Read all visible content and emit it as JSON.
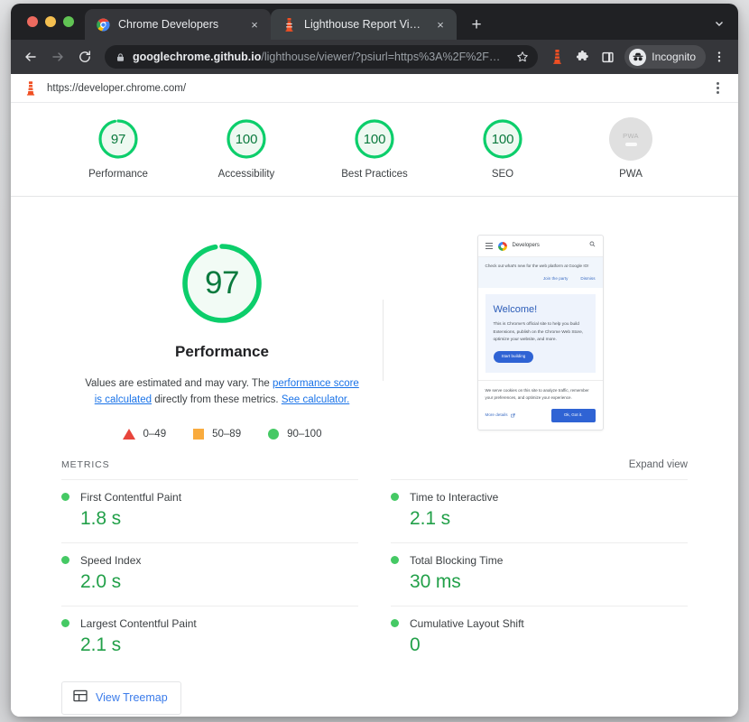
{
  "browser": {
    "tabs": [
      {
        "title": "Chrome Developers",
        "favicon": "chrome-logo-icon",
        "active": false,
        "close_label": "×"
      },
      {
        "title": "Lighthouse Report Viewer",
        "favicon": "lighthouse-icon",
        "active": true,
        "close_label": "×"
      }
    ],
    "new_tab_label": "+",
    "omnibox": {
      "host": "googlechrome.github.io",
      "path": "/lighthouse/viewer/?psiurl=https%3A%2F%2F…",
      "full_url": "googlechrome.github.io/lighthouse/viewer/?psiurl=https%3A%2F%2F…",
      "lock_icon": "lock-icon",
      "star_icon": "bookmark-star-icon"
    },
    "toolbar_icons": [
      "back-arrow-icon",
      "forward-arrow-icon",
      "reload-icon",
      "lighthouse-extension-icon",
      "extensions-puzzle-icon",
      "side-panel-icon"
    ],
    "profile_chip": {
      "label": "Incognito",
      "icon": "incognito-avatar-icon"
    },
    "menu_icon": "three-dot-menu-icon",
    "tabstrip_menu_icon": "chevron-down-icon"
  },
  "report": {
    "topbar": {
      "icon": "lighthouse-icon",
      "url": "https://developer.chrome.com/",
      "menu_icon": "three-dot-menu-icon"
    },
    "scores": [
      {
        "label": "Performance",
        "value": "97",
        "numeric": 97,
        "type": "gauge"
      },
      {
        "label": "Accessibility",
        "value": "100",
        "numeric": 100,
        "type": "gauge"
      },
      {
        "label": "Best Practices",
        "value": "100",
        "numeric": 100,
        "type": "gauge"
      },
      {
        "label": "SEO",
        "value": "100",
        "numeric": 100,
        "type": "gauge"
      },
      {
        "label": "PWA",
        "value": "PWA",
        "numeric": null,
        "type": "pwa"
      }
    ],
    "hero": {
      "score": "97",
      "score_numeric": 97,
      "title": "Performance",
      "desc_part1": "Values are estimated and may vary. The ",
      "desc_link1": "performance score is calculated",
      "desc_part2": " directly from these metrics. ",
      "desc_link2": "See calculator.",
      "legend": [
        {
          "icon": "red-triangle-icon",
          "label": "0–49"
        },
        {
          "icon": "orange-square-icon",
          "label": "50–89"
        },
        {
          "icon": "green-circle-icon",
          "label": "90–100"
        }
      ]
    },
    "thumbnail": {
      "brand": "Developers",
      "burger_icon": "hamburger-menu-icon",
      "logo_icon": "chrome-logo-icon",
      "search_icon": "search-icon",
      "banner_text": "Check out what's new for the web platform at Google IO!",
      "banner_action_1": "Join the party",
      "banner_action_2": "Dismiss",
      "hero_heading": "Welcome!",
      "hero_text": "This is Chrome's official site to help you build Extensions, publish on the Chrome Web Store, optimize your website, and more.",
      "hero_button": "Start building",
      "cookie_text": "We serve cookies on this site to analyze traffic, remember your preferences, and optimize your experience.",
      "cookie_more": "More details",
      "cookie_more_icon": "external-link-icon",
      "cookie_ok": "Ok, Got it."
    },
    "metrics_section": {
      "title": "METRICS",
      "expand_view": "Expand view"
    },
    "metrics": [
      {
        "name": "First Contentful Paint",
        "value": "1.8 s",
        "status": "pass"
      },
      {
        "name": "Time to Interactive",
        "value": "2.1 s",
        "status": "pass"
      },
      {
        "name": "Speed Index",
        "value": "2.0 s",
        "status": "pass"
      },
      {
        "name": "Total Blocking Time",
        "value": "30 ms",
        "status": "pass"
      },
      {
        "name": "Largest Contentful Paint",
        "value": "2.1 s",
        "status": "pass"
      },
      {
        "name": "Cumulative Layout Shift",
        "value": "0",
        "status": "pass"
      }
    ],
    "treemap": {
      "label": "View Treemap",
      "icon": "treemap-icon"
    }
  },
  "colors": {
    "pass_green": "#0cce6b",
    "pass_green_text": "#22a049",
    "score_text_green": "#0b7a3e",
    "average_orange": "#f9ab3e",
    "fail_red": "#e8453c",
    "link_blue": "#1a73e8",
    "chrome_dark": "#202124",
    "toolbar_dark": "#35363a"
  }
}
